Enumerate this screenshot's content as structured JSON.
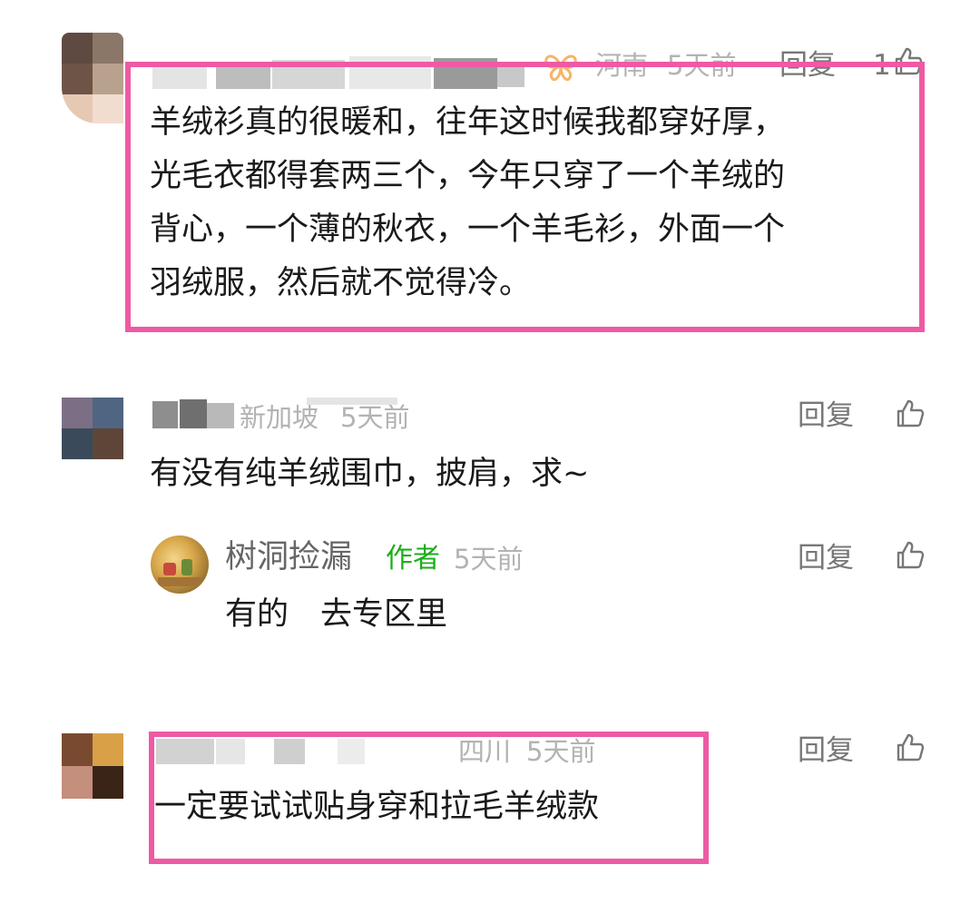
{
  "comments": [
    {
      "location": "河南",
      "time": "5天前",
      "reply_label": "回复",
      "like_count": "1",
      "text_lines": [
        "羊绒衫真的很暖和，往年这时候我都穿好厚，",
        "光毛衣都得套两三个，今年只穿了一个羊绒的",
        "背心，一个薄的秋衣，一个羊毛衫，外面一个",
        "羽绒服，然后就不觉得冷。"
      ]
    },
    {
      "location": "新加坡",
      "time": "5天前",
      "reply_label": "回复",
      "text": "有没有纯羊绒围巾，披肩，求~",
      "reply": {
        "name": "树洞捡漏",
        "badge": "作者",
        "time": "5天前",
        "reply_label": "回复",
        "text": "有的　去专区里"
      }
    },
    {
      "location": "四川",
      "time": "5天前",
      "reply_label": "回复",
      "text": "一定要试试贴身穿和拉毛羊绒款"
    }
  ],
  "colors": {
    "highlight": "#ee5aa4",
    "author_badge": "#1aad19",
    "meta_text": "#b3b3b3",
    "reply_text": "#777777"
  },
  "icons": {
    "like": "thumbs-up-outline-icon",
    "vip": "butterfly-badge-icon"
  }
}
